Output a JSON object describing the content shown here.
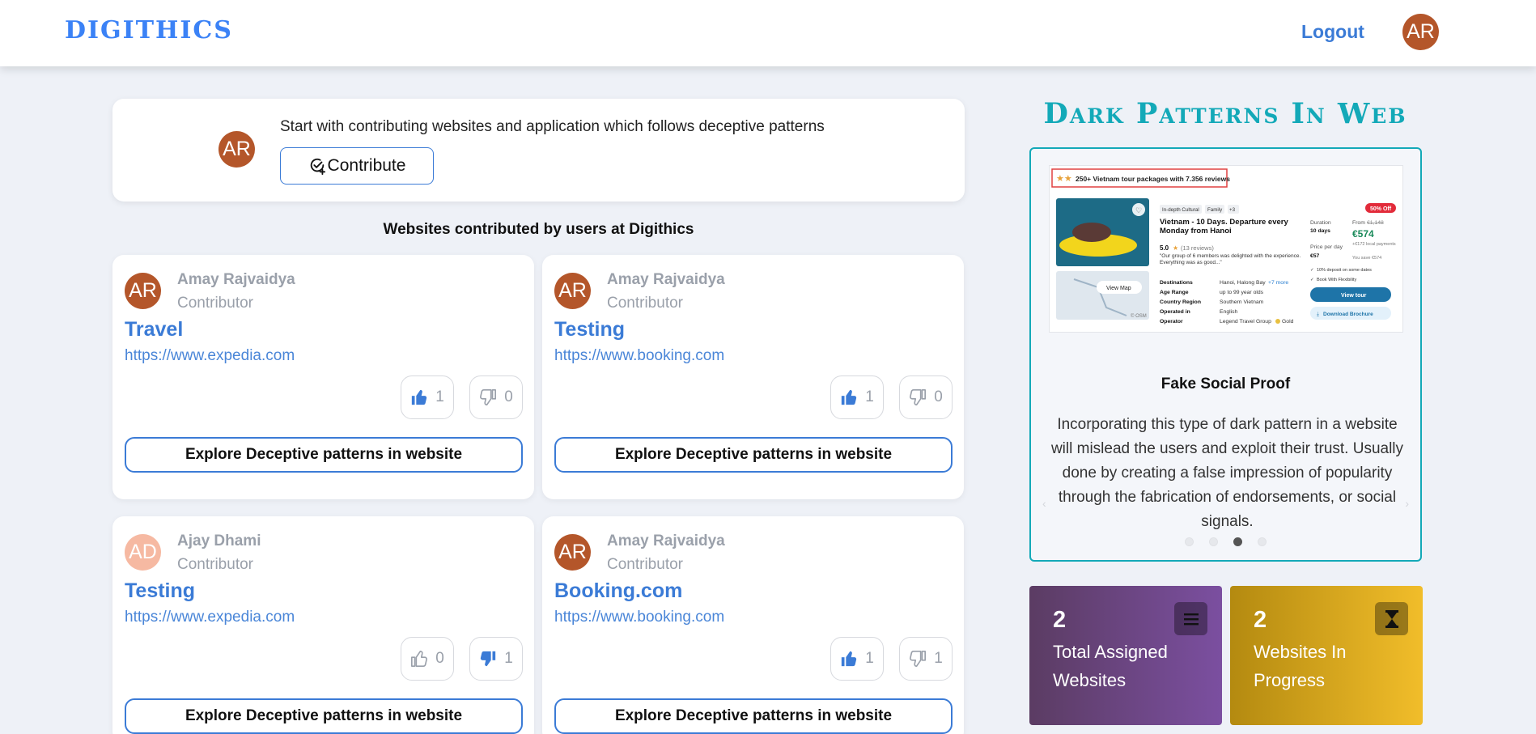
{
  "header": {
    "brand": "DIGITHICS",
    "logout_label": "Logout",
    "user_initials": "AR"
  },
  "contribute": {
    "initials": "AR",
    "prompt": "Start with contributing websites and application which follows deceptive patterns",
    "button_label": "Contribute"
  },
  "section_title": "Websites contributed by users at Digithics",
  "websites": [
    {
      "initials": "AR",
      "avatar_color": "#b4562a",
      "contributor": "Amay Rajvaidya",
      "role": "Contributor",
      "title": "Travel",
      "url": "https://www.expedia.com",
      "upvotes": "1",
      "downvotes": "0",
      "upvoted": true,
      "downvoted": false,
      "explore_label": "Explore Deceptive patterns in website"
    },
    {
      "initials": "AR",
      "avatar_color": "#b4562a",
      "contributor": "Amay Rajvaidya",
      "role": "Contributor",
      "title": "Testing",
      "url": "https://www.booking.com",
      "upvotes": "1",
      "downvotes": "0",
      "upvoted": true,
      "downvoted": false,
      "explore_label": "Explore Deceptive patterns in website"
    },
    {
      "initials": "AD",
      "avatar_color": "#f6b9a2",
      "contributor": "Ajay Dhami",
      "role": "Contributor",
      "title": "Testing",
      "url": "https://www.expedia.com",
      "upvotes": "0",
      "downvotes": "1",
      "upvoted": false,
      "downvoted": true,
      "explore_label": "Explore Deceptive patterns in website"
    },
    {
      "initials": "AR",
      "avatar_color": "#b4562a",
      "contributor": "Amay Rajvaidya",
      "role": "Contributor",
      "title": "Booking.com",
      "url": "https://www.booking.com",
      "upvotes": "1",
      "downvotes": "1",
      "upvoted": true,
      "downvoted": false,
      "explore_label": "Explore Deceptive patterns in website"
    }
  ],
  "dark_patterns": {
    "title": "Dark Patterns In Web",
    "slide_heading": "Fake Social Proof",
    "slide_description": "Incorporating this type of dark pattern in a website will mislead the users and exploit their trust. Usually done by creating a false impression of popularity through the fabrication of endorsements, or social signals.",
    "slide_count": 4,
    "active_slide": 3,
    "example": {
      "banner": "250+ Vietnam tour packages with 7.356 reviews",
      "tags": [
        "In-depth Cultural",
        "Family",
        "+3"
      ],
      "discount_badge": "50% Off",
      "tour_title": "Vietnam - 10 Days. Departure every Monday from Hanoi",
      "rating": "5.0",
      "reviews": "(13 reviews)",
      "quote": "\"Our group of 6 members was delighted with the experience. Everything was as good...\"",
      "details": [
        {
          "label": "Destinations",
          "value": "Hanoi, Halong Bay"
        },
        {
          "label": "Age Range",
          "value": "up to 99 year olds"
        },
        {
          "label": "Country Region",
          "value": "Southern Vietnam"
        },
        {
          "label": "Operated in",
          "value": "English"
        },
        {
          "label": "Operator",
          "value": "Legend Travel Group"
        }
      ],
      "more_link": "+7 more",
      "operator_badge": "Gold",
      "duration_label": "Duration",
      "duration_value": "10 days",
      "from_label": "From",
      "old_price": "€1,148",
      "new_price": "€574",
      "price_note": "+€172 local payments",
      "savings": "You save €574",
      "price_per_day_label": "Price per day",
      "price_per_day": "€57",
      "check_1": "10% deposit on some dates",
      "check_2": "Book With Flexibility",
      "view_tour": "View tour",
      "brochure": "Download Brochure",
      "view_map": "View Map",
      "map_credit": "© OSM"
    }
  },
  "stats": [
    {
      "value": "2",
      "label": "Total Assigned Websites",
      "icon": "menu-icon"
    },
    {
      "value": "2",
      "label": "Websites In Progress",
      "icon": "hourglass-icon"
    }
  ],
  "colors": {
    "accent": "#3b7bd6",
    "teal": "#13a9b8",
    "avatar": "#b4562a"
  }
}
